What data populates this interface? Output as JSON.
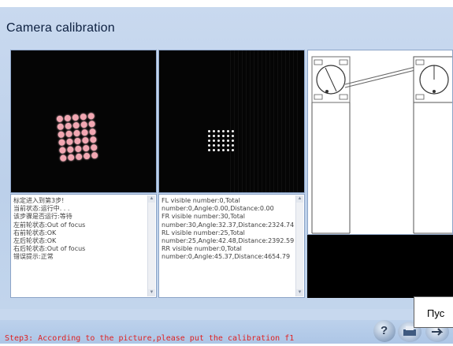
{
  "window": {
    "title": "Camera calibration"
  },
  "camera_left": {
    "grid_cols": 5,
    "grid_rows": 6
  },
  "camera_right": {
    "grid_cols": 6,
    "grid_rows": 5
  },
  "log_left": {
    "lines": [
      "标定进入到第3步!",
      "当前状态:运行中. . .",
      "该步骤是否运行:等待",
      "左前轮状态:Out of focus",
      "右前轮状态:OK",
      "左后轮状态:OK",
      "右后轮状态:Out of focus",
      "错误提示:正常"
    ]
  },
  "log_right": {
    "lines": [
      "FL visible number:0,Total",
      "number:0,Angle:0.00,Distance:0.00",
      "FR visible number:30,Total",
      "number:30,Angle:32.37,Distance:2324.74",
      "RL visible number:25,Total",
      "number:25,Angle:42.48,Distance:2392.59",
      "RR visible number:0,Total",
      "number:0,Angle:45.37,Distance:4654.79"
    ]
  },
  "status": {
    "step_text": "Step3: According to the picture,please put the calibration f1"
  },
  "tooltip": {
    "text": "Пус"
  },
  "buttons": {
    "help_label": "?"
  },
  "colors": {
    "step_text": "#e02222",
    "background": "#c9d9ef"
  }
}
